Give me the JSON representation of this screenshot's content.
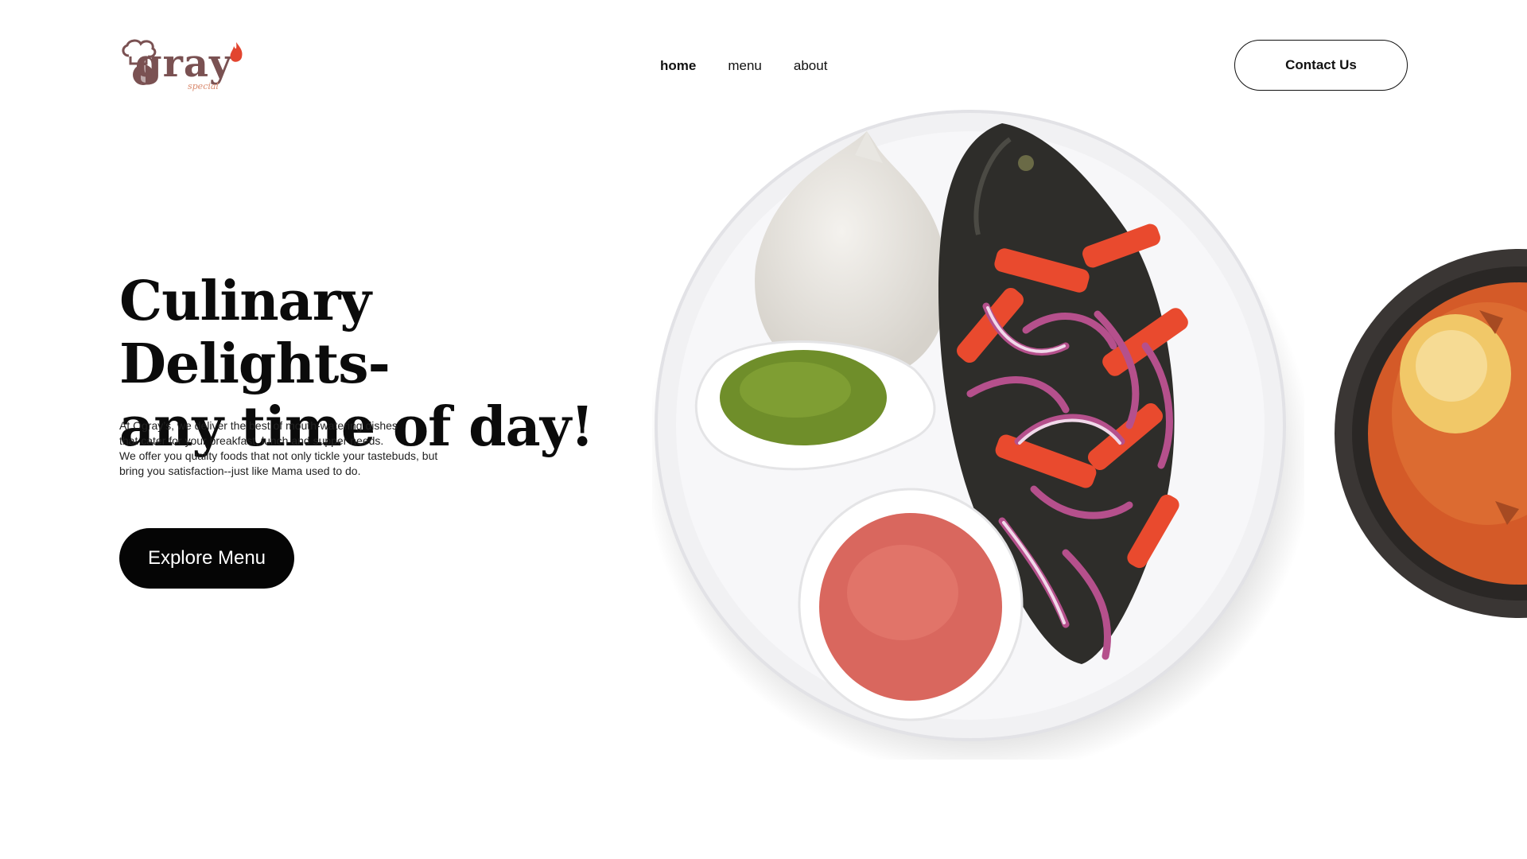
{
  "brand": {
    "name": "gray",
    "subtitle": "special",
    "logo_icon": "chef-hat-icon",
    "accent_color": "#7a5152",
    "flame_color": "#e2452f"
  },
  "nav": {
    "items": [
      {
        "label": "home",
        "active": true
      },
      {
        "label": "menu",
        "active": false
      },
      {
        "label": "about",
        "active": false
      }
    ]
  },
  "header": {
    "contact_label": "Contact Us"
  },
  "hero": {
    "title_line1": "Culinary Delights-",
    "title_line2": "any time of day!",
    "desc_line1": "At Ogray’s, we deliver the best of mouth-watering dishes",
    "desc_line2": "that cater for your breakfast, lunch and supper needs.",
    "desc_line3": "We offer you quality foods that not only tickle your tastebuds, but",
    "desc_line4": "bring you satisfaction--just like Mama used to do.",
    "cta_label": "Explore Menu"
  },
  "images": {
    "plate": "grilled-tilapia-banku-plate-image",
    "bowl": "light-soup-clay-bowl-image"
  }
}
